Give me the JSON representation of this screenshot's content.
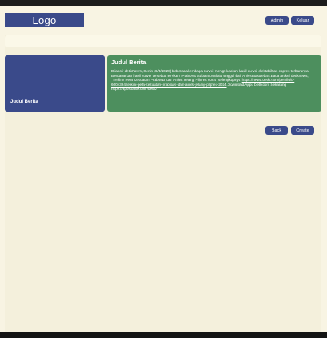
{
  "header": {
    "logo": "Logo",
    "admin_label": "Admin",
    "keluar_label": "Keluar"
  },
  "card": {
    "image_title": "Judul Berita",
    "title": "Judul Berita",
    "text_before_link": "Dilansir detikNews, Senin (6/3/2023) beberapa lembaga survei mengeluarkan hasil survei elektabilitas capres terbarunya. Berdasarkan hasil survei tersebut terekam Prabowo Subianto selalu unggul dari Anies Baswedan.Baca artikel detiknews, \"Terkini! Peta Kekuatan Prabowo dan Anies Jelang Pilpres 2024\" selengkapnya ",
    "link_text": "https://news.detik.com/pemilu/d-6604364/terkini-peta-kekuatan-prabowo-dan-anies-jelang-pilpres-2024",
    "text_after_link": ".Download Apps Detikcom Sekarang https://apps.detik.com/detik/"
  },
  "actions": {
    "back_label": "Back",
    "create_label": "Create"
  },
  "colors": {
    "background": "#f8f4e3",
    "primary": "#3a4a8a",
    "card_green": "#4d8f5e"
  }
}
